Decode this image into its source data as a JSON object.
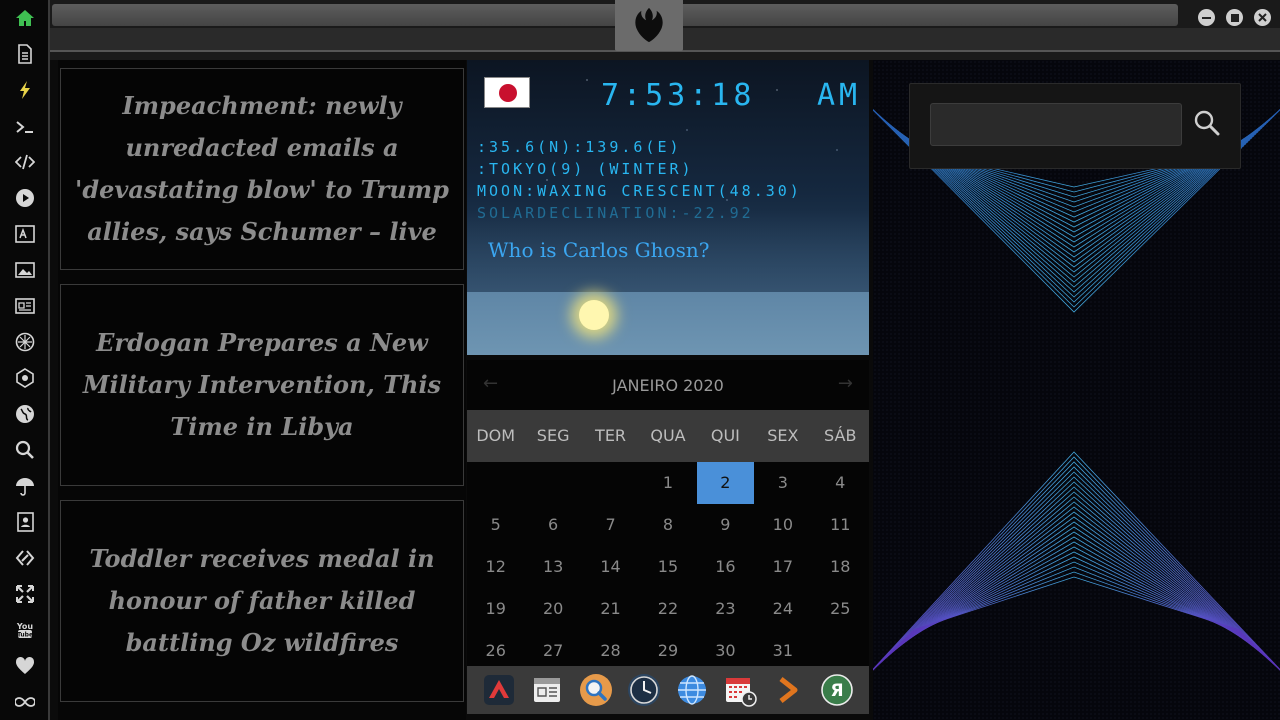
{
  "sidebar": {
    "icons": [
      "home-icon",
      "document-icon",
      "bolt-icon",
      "terminal-icon",
      "code-icon",
      "play-icon",
      "translate-icon",
      "image-icon",
      "news-icon",
      "rebel-alliance-icon",
      "empire-icon",
      "globe-icon",
      "search-icon",
      "umbrella-icon",
      "contacts-icon",
      "link-icon",
      "expand-icon",
      "youtube-icon",
      "heart-icon",
      "infinity-icon"
    ]
  },
  "news": [
    {
      "headline": "Impeachment: newly unredacted emails a 'devastating blow' to Trump allies, says Schumer – live"
    },
    {
      "headline": "Erdogan Prepares a New Military Intervention, This Time in Libya"
    },
    {
      "headline": "Toddler receives medal in honour of father killed battling Oz wildfires"
    }
  ],
  "clock": {
    "flag": "japan-flag",
    "time": "7:53:18",
    "ampm": "AM",
    "coords": ":35.6(N):139.6(E)",
    "location": ":TOKYO(9) (WINTER)",
    "moon": "MOON:WAXING CRESCENT(48.30)",
    "solar": "SOLARDECLINATION:-22.92",
    "question": "Who is Carlos Ghosn?"
  },
  "calendar": {
    "month": "JANEIRO 2020",
    "weekdays": [
      "DOM",
      "SEG",
      "TER",
      "QUA",
      "QUI",
      "SEX",
      "SÁB"
    ],
    "weeks": [
      [
        "",
        "",
        "",
        "1",
        "2",
        "3",
        "4"
      ],
      [
        "5",
        "6",
        "7",
        "8",
        "9",
        "10",
        "11"
      ],
      [
        "12",
        "13",
        "14",
        "15",
        "16",
        "17",
        "18"
      ],
      [
        "19",
        "20",
        "21",
        "22",
        "23",
        "24",
        "25"
      ],
      [
        "26",
        "27",
        "28",
        "29",
        "30",
        "31",
        ""
      ]
    ],
    "today": "2"
  },
  "dock": {
    "icons": [
      "red-triangle-app-icon",
      "calendar-notes-icon",
      "search-app-icon",
      "clock-app-icon",
      "web-browser-icon",
      "calendar-app-icon",
      "forward-arrow-icon",
      "yandex-icon"
    ]
  },
  "search": {
    "value": "",
    "placeholder": ""
  },
  "colors": {
    "accent": "#29b6f0",
    "today": "#4a90d9",
    "home": "#3fbf52",
    "bolt": "#e9d44a"
  }
}
